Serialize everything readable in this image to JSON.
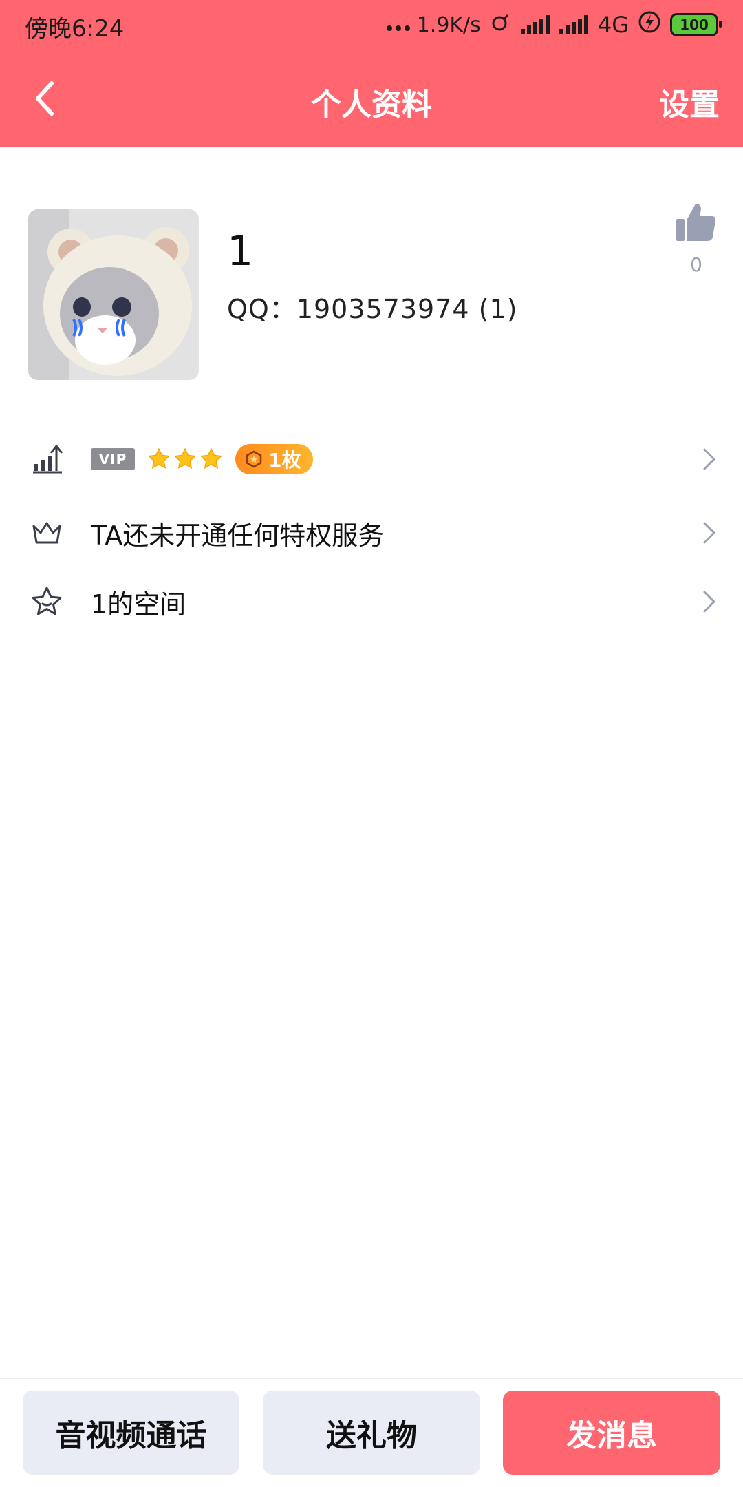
{
  "status_bar": {
    "time": "傍晚6:24",
    "net_speed": "1.9K/s",
    "network_type": "4G",
    "battery": "100"
  },
  "header": {
    "title": "个人资料",
    "settings_label": "设置"
  },
  "profile": {
    "name": "1",
    "qq": "QQ：1903573974 (1)",
    "like_count": "0"
  },
  "list": {
    "vip_badge": "VIP",
    "star_count": 3,
    "medal_label": "1枚",
    "privilege_text": "TA还未开通任何特权服务",
    "space_text": "1的空间"
  },
  "bottom": {
    "call_label": "音视频通话",
    "gift_label": "送礼物",
    "message_label": "发消息"
  },
  "colors": {
    "accent": "#FF6670",
    "secondary_button": "#E9ECF5",
    "medal": "#FF9A24"
  }
}
